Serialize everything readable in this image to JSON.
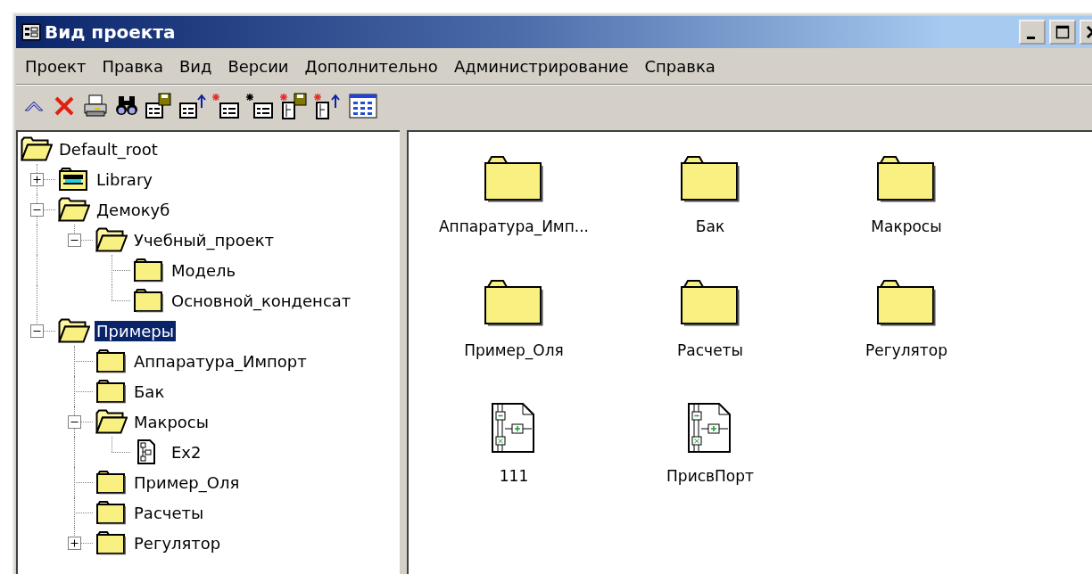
{
  "window": {
    "title": "Вид проекта"
  },
  "menu": [
    "Проект",
    "Правка",
    "Вид",
    "Версии",
    "Дополнительно",
    "Администрирование",
    "Справка"
  ],
  "tree": {
    "label": "Default_root",
    "kind": "folder",
    "expanded": true,
    "selected": false,
    "children": [
      {
        "label": "Library",
        "kind": "library",
        "expanded": false,
        "selected": false
      },
      {
        "label": "Демокуб",
        "kind": "folder",
        "expanded": true,
        "selected": false,
        "children": [
          {
            "label": "Учебный_проект",
            "kind": "folder",
            "expanded": true,
            "selected": false,
            "children": [
              {
                "label": "Модель",
                "kind": "folder",
                "selected": false
              },
              {
                "label": "Основной_конденсат",
                "kind": "folder",
                "selected": false
              }
            ]
          }
        ]
      },
      {
        "label": "Примеры",
        "kind": "folder",
        "expanded": true,
        "selected": true,
        "children": [
          {
            "label": "Аппаратура_Импорт",
            "kind": "folder",
            "selected": false
          },
          {
            "label": "Бак",
            "kind": "folder",
            "selected": false
          },
          {
            "label": "Макросы",
            "kind": "folder",
            "expanded": true,
            "selected": false,
            "children": [
              {
                "label": "Ex2",
                "kind": "diagram",
                "selected": false
              }
            ]
          },
          {
            "label": "Пример_Оля",
            "kind": "folder",
            "selected": false
          },
          {
            "label": "Расчеты",
            "kind": "folder",
            "selected": false
          },
          {
            "label": "Регулятор",
            "kind": "folder",
            "expanded": false,
            "selected": false
          }
        ]
      }
    ]
  },
  "items": [
    {
      "label": "Аппаратура_Имп...",
      "kind": "folder"
    },
    {
      "label": "Бак",
      "kind": "folder"
    },
    {
      "label": "Макросы",
      "kind": "folder"
    },
    {
      "label": "Пример_Оля",
      "kind": "folder"
    },
    {
      "label": "Расчеты",
      "kind": "folder"
    },
    {
      "label": "Регулятор",
      "kind": "folder"
    },
    {
      "label": "111",
      "kind": "diagram"
    },
    {
      "label": "ПрисвПорт",
      "kind": "diagram"
    }
  ]
}
